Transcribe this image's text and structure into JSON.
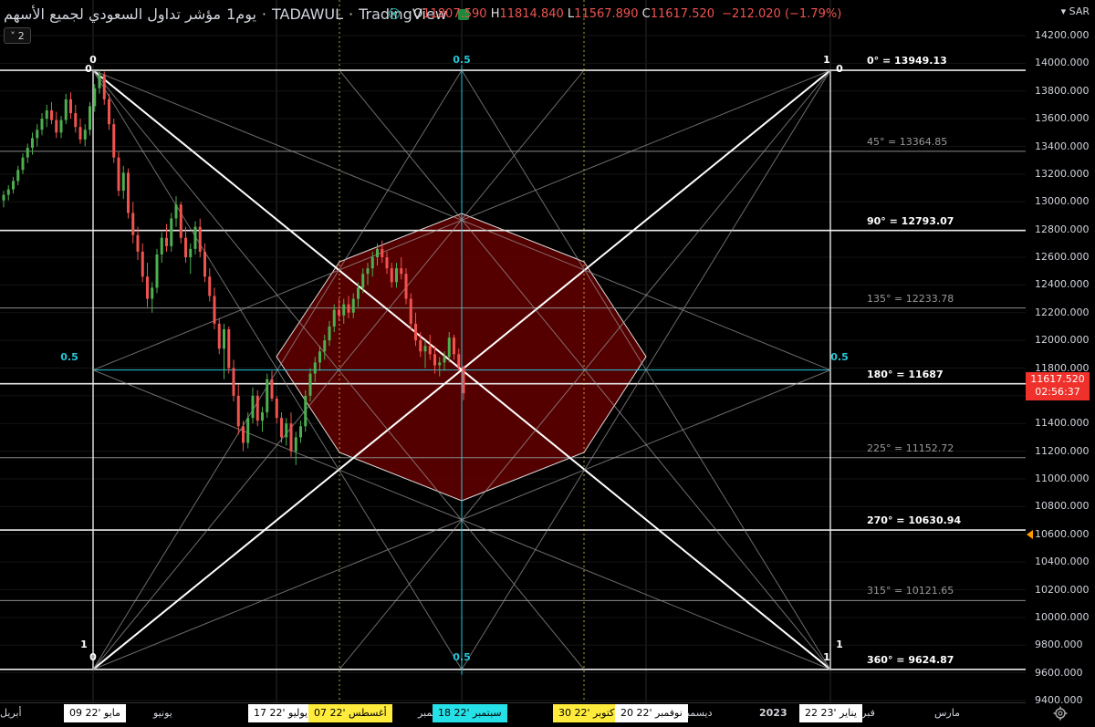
{
  "header": {
    "symbol_title": "مؤشر تداول السعودي لجميع الأسهم",
    "interval": "يوم1",
    "exchange": "TADAWUL",
    "brand": "TradingView",
    "ohlc": {
      "o_label": "O",
      "o": "11807.590",
      "h_label": "H",
      "h": "11814.840",
      "l_label": "L",
      "l": "11567.890",
      "c_label": "C",
      "c": "11617.520",
      "change": "−212.020 (−1.79%)"
    },
    "collapse_count": "2",
    "currency": "SAR"
  },
  "price_scale": {
    "ticks": [
      "14200.000",
      "14000.000",
      "13800.000",
      "13600.000",
      "13400.000",
      "13200.000",
      "13000.000",
      "12800.000",
      "12600.000",
      "12400.000",
      "12200.000",
      "12000.000",
      "11800.000",
      "11600.000",
      "11400.000",
      "11200.000",
      "11000.000",
      "10800.000",
      "10600.000",
      "10400.000",
      "10200.000",
      "10000.000",
      "9800.000",
      "9600.000",
      "9400.000"
    ],
    "last_price": "11617.520",
    "countdown": "02:56:37",
    "last_price_color": "#f0302a"
  },
  "time_axis": {
    "ticks": [
      {
        "label": "أبريل"
      },
      {
        "label": "يونيو"
      },
      {
        "label": "سبتمبر"
      },
      {
        "label": "أكتوبر"
      },
      {
        "label": "ديسمبر"
      },
      {
        "label": "2023"
      },
      {
        "label": "فبراير"
      },
      {
        "label": "مارس"
      }
    ],
    "badges": [
      {
        "label": "09 مايو '22",
        "style": "white"
      },
      {
        "label": "17 يوليو '22",
        "style": "white"
      },
      {
        "label": "07 أغسطس '22",
        "style": "yellow"
      },
      {
        "label": "18 سبتمبر '22",
        "style": "cyan"
      },
      {
        "label": "30 أكتوبر '22",
        "style": "yellow"
      },
      {
        "label": "20 نوفمبر '22",
        "style": "white"
      },
      {
        "label": "22 يناير '23",
        "style": "white"
      }
    ]
  },
  "gann_box": {
    "corner_labels": [
      "0",
      "0.5",
      "1"
    ],
    "levels": [
      {
        "label": "0° = 13949.13",
        "price": 13949.13,
        "bold": true
      },
      {
        "label": "45° = 13364.85",
        "price": 13364.85,
        "bold": false
      },
      {
        "label": "90° = 12793.07",
        "price": 12793.07,
        "bold": true
      },
      {
        "label": "135° = 12233.78",
        "price": 12233.78,
        "bold": false
      },
      {
        "label": "180° = 11687",
        "price": 11687,
        "bold": true
      },
      {
        "label": "225° = 11152.72",
        "price": 11152.72,
        "bold": false
      },
      {
        "label": "270° = 10630.94",
        "price": 10630.94,
        "bold": true
      },
      {
        "label": "315° = 10121.65",
        "price": 10121.65,
        "bold": false
      },
      {
        "label": "360° = 9624.87",
        "price": 9624.87,
        "bold": true
      }
    ],
    "octagon_fill": "#5a0000",
    "accent_cyan": "#26c6da",
    "accent_yellow": "#ffeb3b"
  },
  "chart_data": {
    "type": "candlestick",
    "candles": [
      [
        13010,
        13080,
        12960,
        13050
      ],
      [
        13050,
        13120,
        13010,
        13090
      ],
      [
        13090,
        13180,
        13060,
        13150
      ],
      [
        13150,
        13260,
        13120,
        13230
      ],
      [
        13230,
        13350,
        13200,
        13320
      ],
      [
        13320,
        13420,
        13280,
        13390
      ],
      [
        13390,
        13500,
        13340,
        13460
      ],
      [
        13460,
        13560,
        13400,
        13520
      ],
      [
        13520,
        13640,
        13480,
        13600
      ],
      [
        13600,
        13700,
        13540,
        13660
      ],
      [
        13660,
        13720,
        13560,
        13590
      ],
      [
        13590,
        13650,
        13460,
        13500
      ],
      [
        13500,
        13620,
        13460,
        13590
      ],
      [
        13590,
        13780,
        13560,
        13740
      ],
      [
        13740,
        13790,
        13600,
        13640
      ],
      [
        13640,
        13700,
        13500,
        13540
      ],
      [
        13540,
        13600,
        13420,
        13450
      ],
      [
        13450,
        13560,
        13400,
        13520
      ],
      [
        13520,
        13720,
        13480,
        13690
      ],
      [
        13690,
        13850,
        13650,
        13820
      ],
      [
        13820,
        13949,
        13780,
        13920
      ],
      [
        13920,
        13940,
        13700,
        13740
      ],
      [
        13740,
        13780,
        13520,
        13560
      ],
      [
        13560,
        13600,
        13280,
        13320
      ],
      [
        13320,
        13360,
        13040,
        13080
      ],
      [
        13080,
        13260,
        13020,
        13210
      ],
      [
        13210,
        13240,
        12880,
        12920
      ],
      [
        12920,
        13000,
        12700,
        12760
      ],
      [
        12760,
        12820,
        12580,
        12640
      ],
      [
        12640,
        12700,
        12420,
        12460
      ],
      [
        12460,
        12560,
        12240,
        12300
      ],
      [
        12300,
        12420,
        12200,
        12380
      ],
      [
        12380,
        12660,
        12340,
        12620
      ],
      [
        12620,
        12780,
        12560,
        12740
      ],
      [
        12740,
        12840,
        12640,
        12680
      ],
      [
        12680,
        12920,
        12640,
        12880
      ],
      [
        12880,
        13040,
        12820,
        12980
      ],
      [
        12980,
        13000,
        12700,
        12740
      ],
      [
        12740,
        12820,
        12560,
        12600
      ],
      [
        12600,
        12700,
        12480,
        12660
      ],
      [
        12660,
        12860,
        12620,
        12820
      ],
      [
        12820,
        12880,
        12600,
        12640
      ],
      [
        12640,
        12700,
        12420,
        12460
      ],
      [
        12460,
        12520,
        12280,
        12320
      ],
      [
        12320,
        12380,
        12080,
        12120
      ],
      [
        12120,
        12160,
        11900,
        11940
      ],
      [
        11940,
        12120,
        11720,
        12080
      ],
      [
        12080,
        12100,
        11760,
        11800
      ],
      [
        11800,
        11860,
        11560,
        11600
      ],
      [
        11600,
        11680,
        11320,
        11380
      ],
      [
        11380,
        11420,
        11200,
        11260
      ],
      [
        11260,
        11480,
        11220,
        11440
      ],
      [
        11440,
        11660,
        11400,
        11600
      ],
      [
        11600,
        11640,
        11380,
        11420
      ],
      [
        11420,
        11520,
        11340,
        11480
      ],
      [
        11480,
        11760,
        11440,
        11720
      ],
      [
        11720,
        11780,
        11560,
        11580
      ],
      [
        11580,
        11600,
        11400,
        11440
      ],
      [
        11440,
        11480,
        11260,
        11300
      ],
      [
        11300,
        11440,
        11240,
        11400
      ],
      [
        11400,
        11480,
        11160,
        11200
      ],
      [
        11200,
        11340,
        11100,
        11300
      ],
      [
        11300,
        11420,
        11260,
        11380
      ],
      [
        11380,
        11640,
        11340,
        11600
      ],
      [
        11600,
        11800,
        11560,
        11760
      ],
      [
        11760,
        11880,
        11700,
        11840
      ],
      [
        11840,
        11960,
        11780,
        11920
      ],
      [
        11920,
        12040,
        11860,
        12000
      ],
      [
        12000,
        12140,
        11960,
        12100
      ],
      [
        12100,
        12260,
        12060,
        12220
      ],
      [
        12220,
        12300,
        12140,
        12180
      ],
      [
        12180,
        12300,
        12120,
        12260
      ],
      [
        12260,
        12320,
        12160,
        12200
      ],
      [
        12200,
        12340,
        12160,
        12300
      ],
      [
        12300,
        12420,
        12240,
        12380
      ],
      [
        12380,
        12520,
        12340,
        12480
      ],
      [
        12480,
        12560,
        12400,
        12520
      ],
      [
        12520,
        12640,
        12460,
        12600
      ],
      [
        12600,
        12700,
        12540,
        12660
      ],
      [
        12660,
        12720,
        12560,
        12600
      ],
      [
        12600,
        12640,
        12480,
        12520
      ],
      [
        12520,
        12560,
        12380,
        12420
      ],
      [
        12420,
        12560,
        12380,
        12520
      ],
      [
        12520,
        12600,
        12440,
        12480
      ],
      [
        12480,
        12520,
        12260,
        12300
      ],
      [
        12300,
        12340,
        12080,
        12120
      ],
      [
        12120,
        12200,
        11960,
        12000
      ],
      [
        12000,
        12060,
        11880,
        11920
      ],
      [
        11920,
        12000,
        11800,
        11960
      ],
      [
        11960,
        12040,
        11860,
        11900
      ],
      [
        11900,
        11960,
        11760,
        11820
      ],
      [
        11820,
        11880,
        11740,
        11840
      ],
      [
        11840,
        11920,
        11780,
        11880
      ],
      [
        11880,
        12060,
        11840,
        12020
      ],
      [
        12020,
        12040,
        11860,
        11900
      ],
      [
        11900,
        11940,
        11780,
        11808
      ],
      [
        11808,
        11815,
        11568,
        11618
      ]
    ],
    "up_color": "#4caf50",
    "down_color": "#ef5350"
  }
}
